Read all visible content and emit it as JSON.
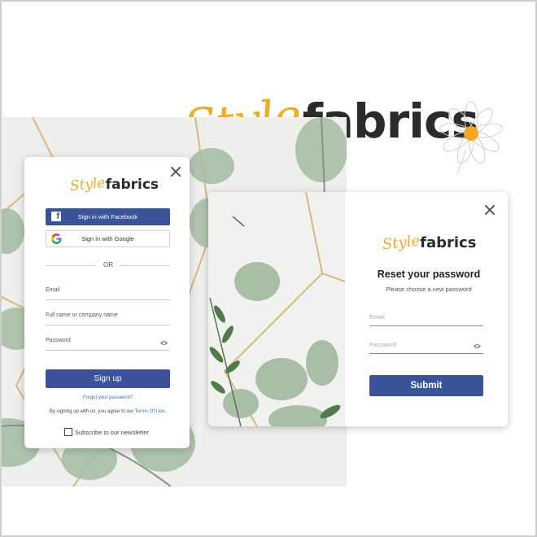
{
  "brand": {
    "script": "Style",
    "word": "fabrics",
    "script_color": "#f0ac1e",
    "word_color": "#2b2b2b"
  },
  "accent_color": "#3b539b",
  "signup_card": {
    "close_icon": "close-icon",
    "facebook_button": "Sign in with Facebook",
    "google_button": "Sign in with Google",
    "or_text": "OR",
    "fields": {
      "email": "Email",
      "name": "Full name or company name",
      "password": "Password"
    },
    "password_toggle_icon": "eye-icon",
    "submit_button": "Sign up",
    "forgot_link": "Forgot your password?",
    "terms_text": "By signing up with us, you agree to our ",
    "terms_link": "Terms Of Use.",
    "newsletter_label": "Subscribe to our newsletter"
  },
  "reset_card": {
    "close_icon": "close-icon",
    "title": "Reset your password",
    "subtitle": "Please choose a new password",
    "fields": {
      "email": "Email",
      "password": "Password"
    },
    "password_toggle_icon": "eye-icon",
    "submit_button": "Submit"
  }
}
